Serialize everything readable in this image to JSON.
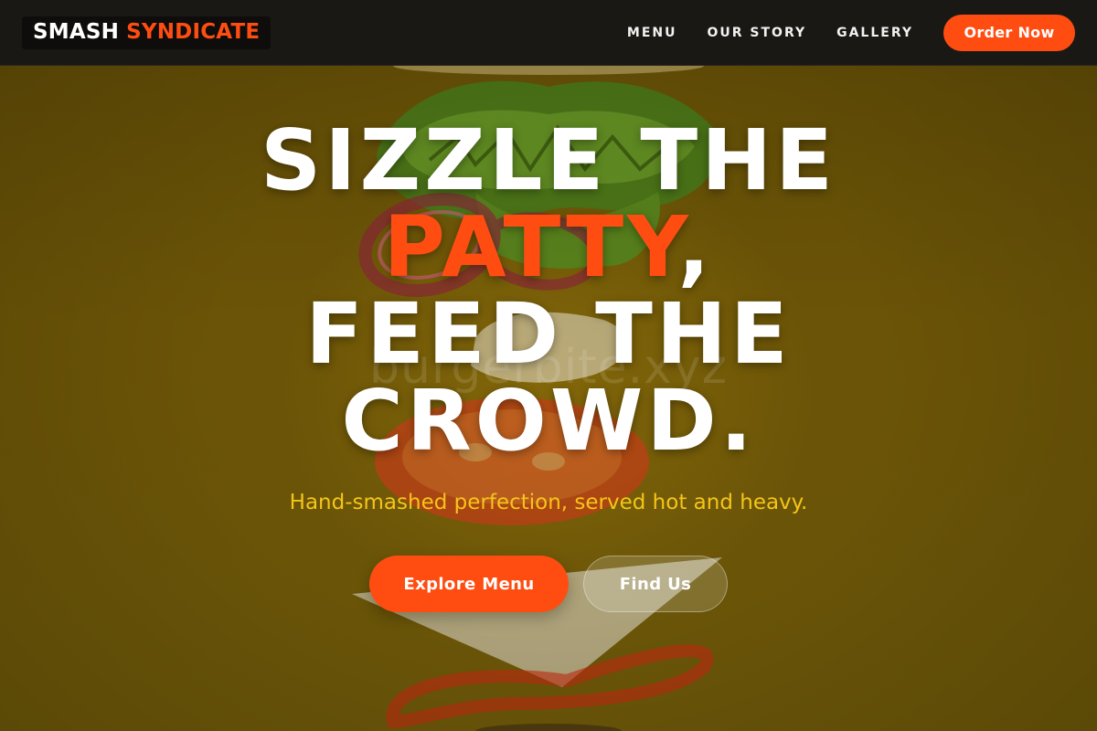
{
  "brand": {
    "name_part1": "SMASH",
    "name_part2": "SYNDICATE"
  },
  "nav": {
    "links": [
      "MENU",
      "OUR STORY",
      "GALLERY"
    ],
    "order_button": "Order Now"
  },
  "hero": {
    "headline_line1": "SIZZLE THE",
    "headline_accent": "PATTY",
    "headline_comma": ",",
    "headline_line3": "FEED THE",
    "headline_line4": "CROWD.",
    "subtitle": "Hand-smashed perfection, served hot and heavy.",
    "primary_button": "Explore Menu",
    "secondary_button": "Find Us",
    "watermark": "burgerbite.xyz"
  },
  "colors": {
    "accent": "#ff4d12",
    "subtitle": "#f5c518",
    "nav_background": "#1a1815",
    "hero_background": "#6a5406"
  },
  "background_image": "floating-burger-ingredients"
}
